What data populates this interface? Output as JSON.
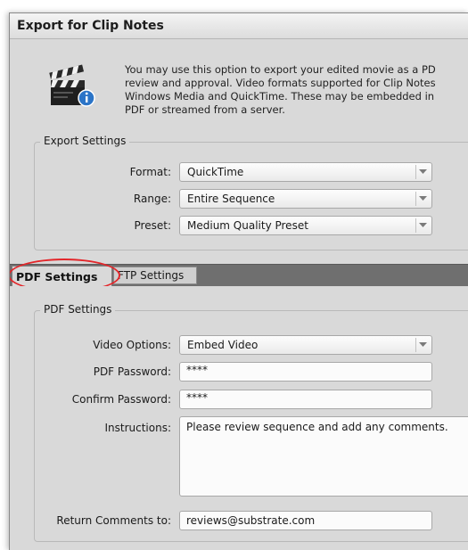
{
  "window": {
    "title": "Export for Clip Notes"
  },
  "intro": {
    "icon": "clapperboard-info-icon",
    "lines": [
      "You may use this option to export your edited movie as a PD",
      "review and approval. Video formats supported for Clip Notes",
      "Windows Media and QuickTime. These may be embedded in",
      "PDF or streamed from a server."
    ]
  },
  "export_settings": {
    "legend": "Export Settings",
    "format": {
      "label": "Format:",
      "value": "QuickTime"
    },
    "range": {
      "label": "Range:",
      "value": "Entire Sequence"
    },
    "preset": {
      "label": "Preset:",
      "value": "Medium Quality Preset"
    }
  },
  "tabs": [
    {
      "label": "PDF Settings",
      "active": true
    },
    {
      "label": "FTP Settings",
      "active": false
    }
  ],
  "pdf_settings": {
    "legend": "PDF Settings",
    "video_options": {
      "label": "Video Options:",
      "value": "Embed Video"
    },
    "pdf_password": {
      "label": "PDF Password:",
      "value": "****"
    },
    "confirm_password": {
      "label": "Confirm Password:",
      "value": "****"
    },
    "instructions": {
      "label": "Instructions:",
      "value": "Please review sequence and add any comments."
    },
    "return_comments": {
      "label": "Return Comments to:",
      "value": "reviews@substrate.com"
    }
  },
  "highlight_color": "#e3262a"
}
